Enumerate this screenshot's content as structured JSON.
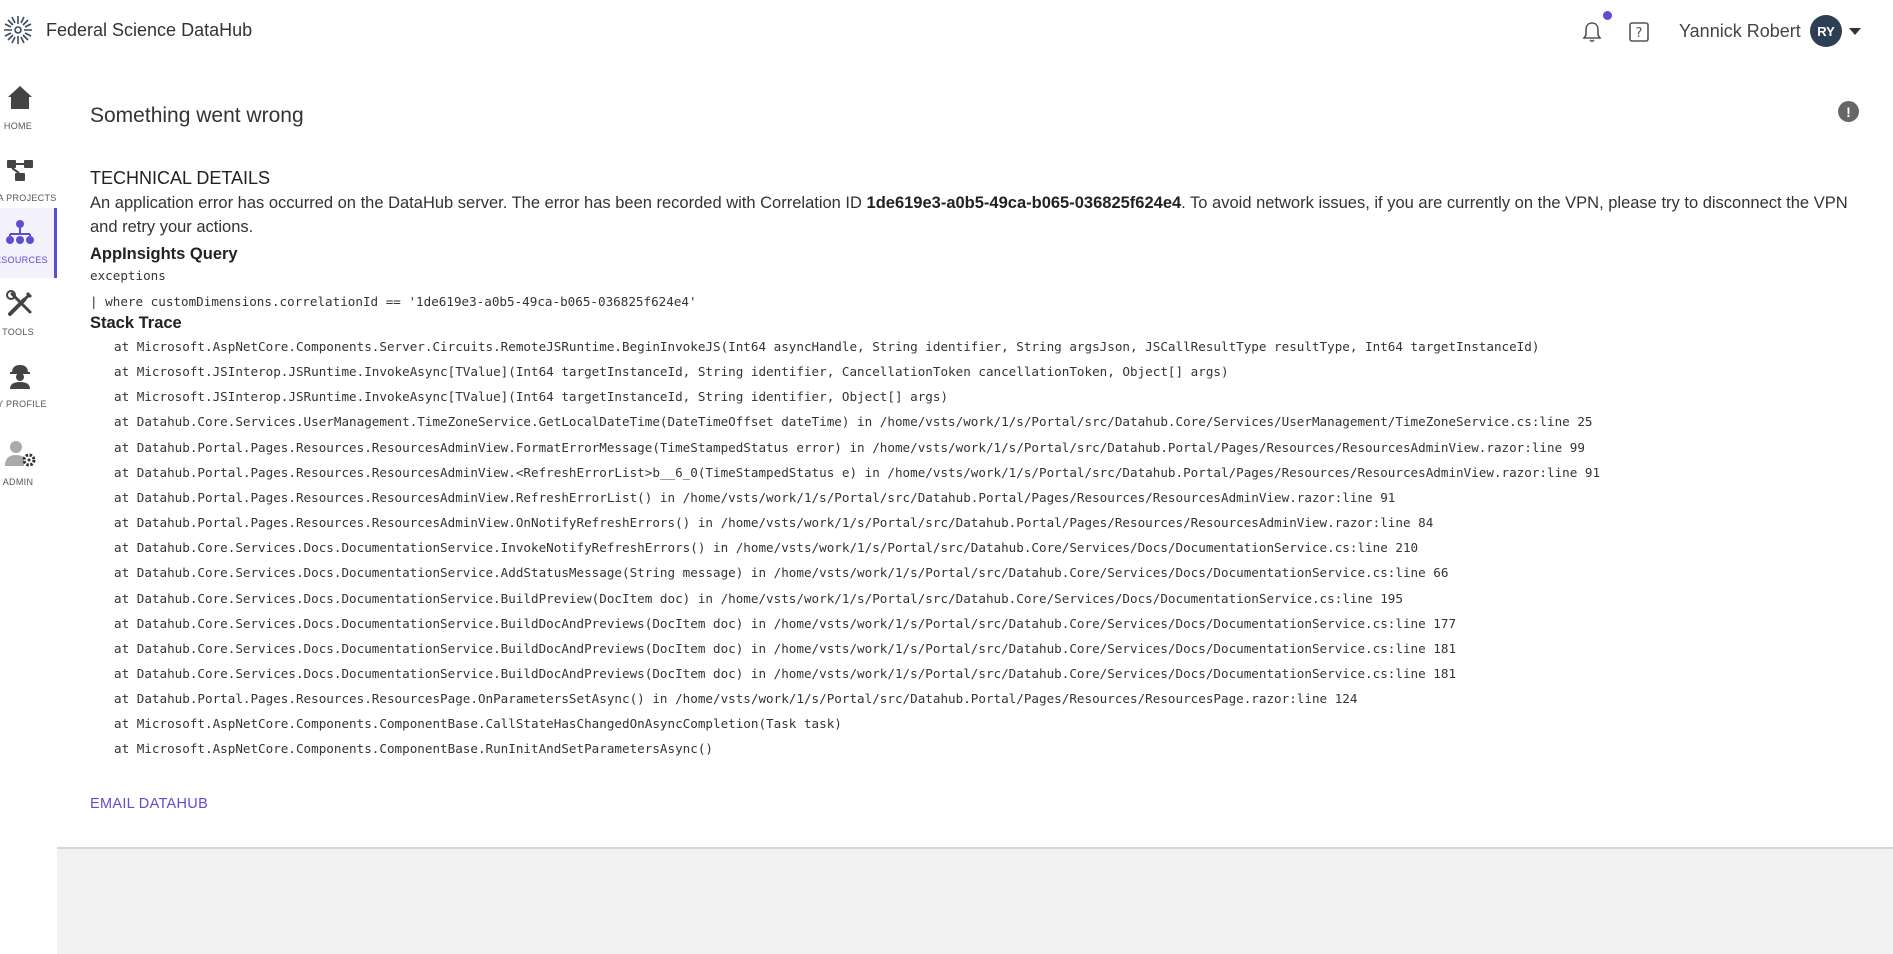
{
  "header": {
    "app_title": "Federal Science DataHub",
    "user_name": "Yannick Robert",
    "avatar_initials": "RY",
    "notification_dot_color": "#5a4fcf"
  },
  "sidebar": {
    "items": [
      {
        "label": "HOME",
        "icon": "home-icon",
        "active": false
      },
      {
        "label": "DATA PROJECTS",
        "icon": "projects-icon",
        "active": false
      },
      {
        "label": "RESOURCES",
        "icon": "resources-icon",
        "active": true
      },
      {
        "label": "TOOLS",
        "icon": "tools-icon",
        "active": false
      },
      {
        "label": "MY PROFILE",
        "icon": "profile-icon",
        "active": false
      },
      {
        "label": "ADMIN",
        "icon": "admin-icon",
        "active": false
      }
    ]
  },
  "main": {
    "title": "Something went wrong",
    "technical_heading": "TECHNICAL DETAILS",
    "error_prefix": "An application error has occurred on the DataHub server. The error has been recorded with Correlation ID ",
    "correlation_id": "1de619e3-a0b5-49ca-b065-036825f624e4",
    "error_suffix": ". To avoid network issues, if you are currently on the VPN, please try to disconnect the VPN and retry your actions.",
    "appinsights_heading": "AppInsights Query",
    "query_lines": [
      "exceptions",
      "| where customDimensions.correlationId == '1de619e3-a0b5-49ca-b065-036825f624e4'"
    ],
    "stack_heading": "Stack Trace",
    "stack_lines": [
      "at Microsoft.AspNetCore.Components.Server.Circuits.RemoteJSRuntime.BeginInvokeJS(Int64 asyncHandle, String identifier, String argsJson, JSCallResultType resultType, Int64 targetInstanceId)",
      "at Microsoft.JSInterop.JSRuntime.InvokeAsync[TValue](Int64 targetInstanceId, String identifier, CancellationToken cancellationToken, Object[] args)",
      "at Microsoft.JSInterop.JSRuntime.InvokeAsync[TValue](Int64 targetInstanceId, String identifier, Object[] args)",
      "at Datahub.Core.Services.UserManagement.TimeZoneService.GetLocalDateTime(DateTimeOffset dateTime) in /home/vsts/work/1/s/Portal/src/Datahub.Core/Services/UserManagement/TimeZoneService.cs:line 25",
      "at Datahub.Portal.Pages.Resources.ResourcesAdminView.FormatErrorMessage(TimeStampedStatus error) in /home/vsts/work/1/s/Portal/src/Datahub.Portal/Pages/Resources/ResourcesAdminView.razor:line 99",
      "at Datahub.Portal.Pages.Resources.ResourcesAdminView.<RefreshErrorList>b__6_0(TimeStampedStatus e) in /home/vsts/work/1/s/Portal/src/Datahub.Portal/Pages/Resources/ResourcesAdminView.razor:line 91",
      "at Datahub.Portal.Pages.Resources.ResourcesAdminView.RefreshErrorList() in /home/vsts/work/1/s/Portal/src/Datahub.Portal/Pages/Resources/ResourcesAdminView.razor:line 91",
      "at Datahub.Portal.Pages.Resources.ResourcesAdminView.OnNotifyRefreshErrors() in /home/vsts/work/1/s/Portal/src/Datahub.Portal/Pages/Resources/ResourcesAdminView.razor:line 84",
      "at Datahub.Core.Services.Docs.DocumentationService.InvokeNotifyRefreshErrors() in /home/vsts/work/1/s/Portal/src/Datahub.Core/Services/Docs/DocumentationService.cs:line 210",
      "at Datahub.Core.Services.Docs.DocumentationService.AddStatusMessage(String message) in /home/vsts/work/1/s/Portal/src/Datahub.Core/Services/Docs/DocumentationService.cs:line 66",
      "at Datahub.Core.Services.Docs.DocumentationService.BuildPreview(DocItem doc) in /home/vsts/work/1/s/Portal/src/Datahub.Core/Services/Docs/DocumentationService.cs:line 195",
      "at Datahub.Core.Services.Docs.DocumentationService.BuildDocAndPreviews(DocItem doc) in /home/vsts/work/1/s/Portal/src/Datahub.Core/Services/Docs/DocumentationService.cs:line 177",
      "at Datahub.Core.Services.Docs.DocumentationService.BuildDocAndPreviews(DocItem doc) in /home/vsts/work/1/s/Portal/src/Datahub.Core/Services/Docs/DocumentationService.cs:line 181",
      "at Datahub.Core.Services.Docs.DocumentationService.BuildDocAndPreviews(DocItem doc) in /home/vsts/work/1/s/Portal/src/Datahub.Core/Services/Docs/DocumentationService.cs:line 181",
      "at Datahub.Portal.Pages.Resources.ResourcesPage.OnParametersSetAsync() in /home/vsts/work/1/s/Portal/src/Datahub.Portal/Pages/Resources/ResourcesPage.razor:line 124",
      "at Microsoft.AspNetCore.Components.ComponentBase.CallStateHasChangedOnAsyncCompletion(Task task)",
      "at Microsoft.AspNetCore.Components.ComponentBase.RunInitAndSetParametersAsync()"
    ],
    "email_link": "EMAIL DATAHUB",
    "accent_color": "#5a4fcf"
  }
}
